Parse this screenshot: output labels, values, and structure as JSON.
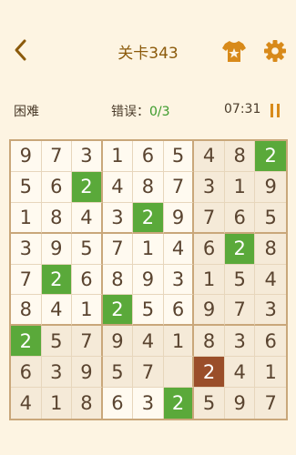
{
  "header": {
    "title": "关卡343",
    "back_icon": "chevron-left-icon",
    "theme_icon": "tshirt-star-icon",
    "settings_icon": "gear-icon"
  },
  "status": {
    "difficulty": "困难",
    "errors_label": "错误：",
    "errors_value": "0/3",
    "timer": "07:31",
    "pause_icon": "pause-icon"
  },
  "colors": {
    "accent": "#8b5a0b",
    "highlight": "#5aa93a",
    "selected": "#9a4e2a",
    "shade": "#f5ead8"
  },
  "board": {
    "grid": [
      [
        "9",
        "7",
        "3",
        "1",
        "6",
        "5",
        "4",
        "8",
        "2"
      ],
      [
        "5",
        "6",
        "2",
        "4",
        "8",
        "7",
        "3",
        "1",
        "9"
      ],
      [
        "1",
        "8",
        "4",
        "3",
        "2",
        "9",
        "7",
        "6",
        "5"
      ],
      [
        "3",
        "9",
        "5",
        "7",
        "1",
        "4",
        "6",
        "2",
        "8"
      ],
      [
        "7",
        "2",
        "6",
        "8",
        "9",
        "3",
        "1",
        "5",
        "4"
      ],
      [
        "8",
        "4",
        "1",
        "2",
        "5",
        "6",
        "9",
        "7",
        "3"
      ],
      [
        "2",
        "5",
        "7",
        "9",
        "4",
        "1",
        "8",
        "3",
        "6"
      ],
      [
        "6",
        "3",
        "9",
        "5",
        "7",
        "",
        "2",
        "4",
        "1"
      ],
      [
        "4",
        "1",
        "8",
        "6",
        "3",
        "2",
        "5",
        "9",
        "7"
      ]
    ],
    "highlighted_cells": [
      [
        0,
        8
      ],
      [
        1,
        2
      ],
      [
        2,
        4
      ],
      [
        3,
        7
      ],
      [
        4,
        1
      ],
      [
        5,
        3
      ],
      [
        6,
        0
      ],
      [
        8,
        5
      ]
    ],
    "selected_cell": [
      7,
      6
    ],
    "shaded_cells": [
      [
        0,
        6
      ],
      [
        0,
        7
      ],
      [
        0,
        8
      ],
      [
        1,
        6
      ],
      [
        1,
        7
      ],
      [
        1,
        8
      ],
      [
        2,
        6
      ],
      [
        2,
        7
      ],
      [
        2,
        8
      ],
      [
        6,
        0
      ],
      [
        6,
        1
      ],
      [
        6,
        2
      ],
      [
        6,
        3
      ],
      [
        6,
        4
      ],
      [
        6,
        5
      ],
      [
        6,
        6
      ],
      [
        6,
        7
      ],
      [
        6,
        8
      ],
      [
        7,
        0
      ],
      [
        7,
        1
      ],
      [
        7,
        2
      ],
      [
        7,
        3
      ],
      [
        7,
        4
      ],
      [
        7,
        5
      ],
      [
        7,
        6
      ],
      [
        7,
        7
      ],
      [
        7,
        8
      ],
      [
        8,
        0
      ],
      [
        8,
        1
      ],
      [
        8,
        2
      ],
      [
        8,
        6
      ],
      [
        8,
        7
      ],
      [
        8,
        8
      ],
      [
        3,
        6
      ],
      [
        3,
        7
      ],
      [
        3,
        8
      ],
      [
        4,
        6
      ],
      [
        4,
        7
      ],
      [
        4,
        8
      ],
      [
        5,
        6
      ],
      [
        5,
        7
      ],
      [
        5,
        8
      ]
    ]
  }
}
